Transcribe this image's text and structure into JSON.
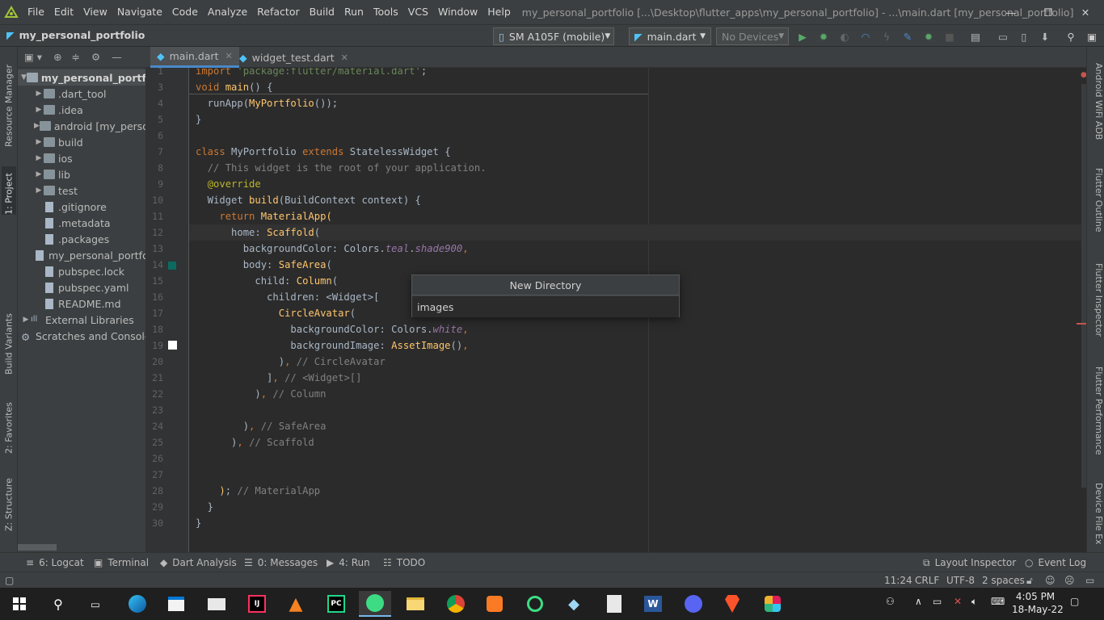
{
  "menu": [
    "File",
    "Edit",
    "View",
    "Navigate",
    "Code",
    "Analyze",
    "Refactor",
    "Build",
    "Run",
    "Tools",
    "VCS",
    "Window",
    "Help"
  ],
  "window_title": "my_personal_portfolio [...\\Desktop\\flutter_apps\\my_personal_portfolio] - ...\\main.dart [my_personal_portfolio]",
  "breadcrumb": "my_personal_portfolio",
  "device_combo": "SM A105F (mobile)",
  "config_combo": "main.dart",
  "devices_combo": "No Devices",
  "left_strip": [
    "Resource Manager",
    "1: Project",
    "Build Variants",
    "2: Favorites",
    "Z: Structure"
  ],
  "right_strip": [
    "Android WiFi ADB",
    "Flutter Outline",
    "Flutter Inspector",
    "Flutter Performance",
    "Device File Ex"
  ],
  "tree": [
    {
      "label": "my_personal_portfolio",
      "bold": true,
      "indent": 0,
      "kind": "folder",
      "expanded": true
    },
    {
      "label": ".dart_tool",
      "indent": 1,
      "kind": "folder"
    },
    {
      "label": ".idea",
      "indent": 1,
      "kind": "folder"
    },
    {
      "label": "android [my_perso",
      "indent": 1,
      "kind": "folder"
    },
    {
      "label": "build",
      "indent": 1,
      "kind": "folder"
    },
    {
      "label": "ios",
      "indent": 1,
      "kind": "folder"
    },
    {
      "label": "lib",
      "indent": 1,
      "kind": "folder"
    },
    {
      "label": "test",
      "indent": 1,
      "kind": "folder"
    },
    {
      "label": ".gitignore",
      "indent": 1,
      "kind": "file"
    },
    {
      "label": ".metadata",
      "indent": 1,
      "kind": "file"
    },
    {
      "label": ".packages",
      "indent": 1,
      "kind": "file"
    },
    {
      "label": "my_personal_portfo",
      "indent": 1,
      "kind": "file"
    },
    {
      "label": "pubspec.lock",
      "indent": 1,
      "kind": "file"
    },
    {
      "label": "pubspec.yaml",
      "indent": 1,
      "kind": "file"
    },
    {
      "label": "README.md",
      "indent": 1,
      "kind": "file"
    },
    {
      "label": "External Libraries",
      "indent": 0,
      "kind": "lib"
    },
    {
      "label": "Scratches and Console",
      "indent": 0,
      "kind": "scratch"
    }
  ],
  "tabs": [
    {
      "label": "main.dart",
      "active": true
    },
    {
      "label": "widget_test.dart",
      "active": false
    }
  ],
  "line_numbers": [
    "1",
    "3",
    "4",
    "5",
    "6",
    "7",
    "8",
    "9",
    "10",
    "11",
    "12",
    "13",
    "14",
    "15",
    "16",
    "17",
    "18",
    "19",
    "20",
    "21",
    "22",
    "23",
    "24",
    "25",
    "26",
    "27",
    "28",
    "29",
    "30"
  ],
  "dialog": {
    "title": "New Directory",
    "value": "images"
  },
  "bottom_tools": [
    "6: Logcat",
    "Terminal",
    "Dart Analysis",
    "0: Messages",
    "4: Run",
    "TODO",
    "Layout Inspector",
    "Event Log"
  ],
  "status": {
    "position": "11:24",
    "line_sep": "CRLF",
    "encoding": "UTF-8",
    "indent": "2 spaces"
  },
  "clock": {
    "time": "4:05 PM",
    "date": "18-May-22"
  },
  "colors": {
    "accent": "#4a88c7",
    "keyword": "#cc7832",
    "function": "#ffc66d",
    "comment": "#808080"
  }
}
